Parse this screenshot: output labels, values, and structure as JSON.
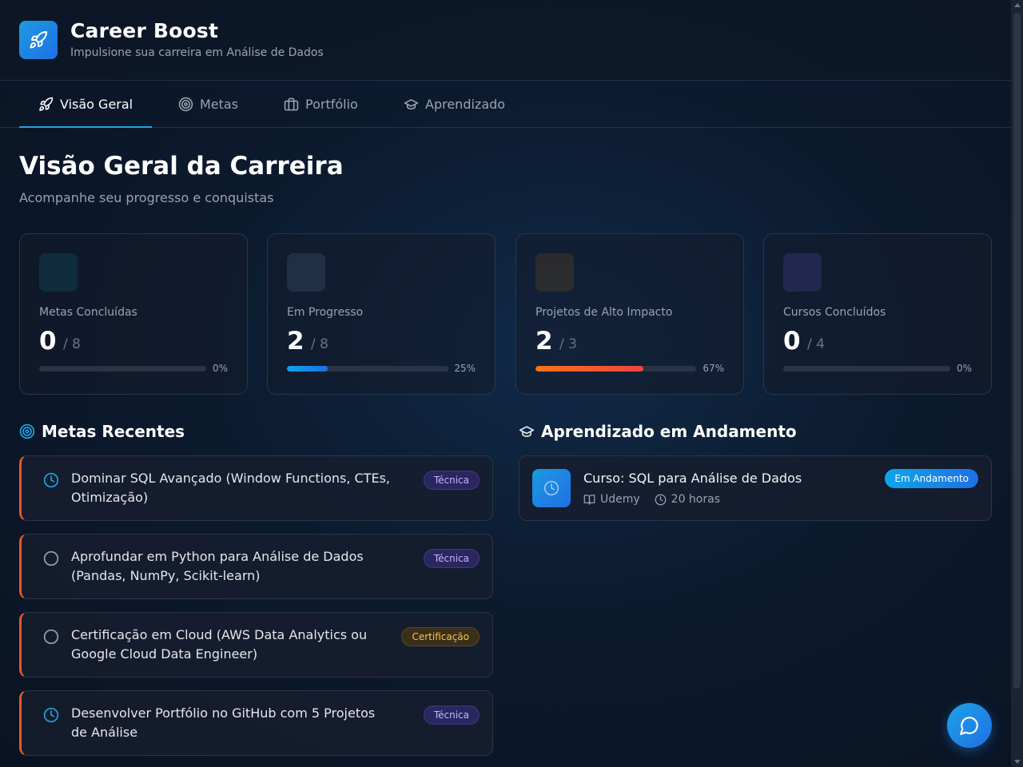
{
  "header": {
    "title": "Career Boost",
    "subtitle": "Impulsione sua carreira em Análise de Dados"
  },
  "tabs": [
    {
      "label": "Visão Geral",
      "icon": "rocket-icon",
      "active": true
    },
    {
      "label": "Metas",
      "icon": "target-icon",
      "active": false
    },
    {
      "label": "Portfólio",
      "icon": "briefcase-icon",
      "active": false
    },
    {
      "label": "Aprendizado",
      "icon": "graduation-cap-icon",
      "active": false
    }
  ],
  "main": {
    "title": "Visão Geral da Carreira",
    "subtitle": "Acompanhe seu progresso e conquistas"
  },
  "stats": [
    {
      "label": "Metas Concluídas",
      "value": "0",
      "total": "/ 8",
      "percent": "0%",
      "progress": 0,
      "color": "#1e9ae0"
    },
    {
      "label": "Em Progresso",
      "value": "2",
      "total": "/ 8",
      "percent": "25%",
      "progress": 0.25,
      "color": "#1e9ae0"
    },
    {
      "label": "Projetos de Alto Impacto",
      "value": "2",
      "total": "/ 3",
      "percent": "67%",
      "progress": 0.67,
      "color": "#f97316"
    },
    {
      "label": "Cursos Concluídos",
      "value": "0",
      "total": "/ 4",
      "percent": "0%",
      "progress": 0,
      "color": "#6366f1"
    }
  ],
  "recent_goals": {
    "title": "Metas Recentes",
    "items": [
      {
        "text": "Dominar SQL Avançado (Window Functions, CTEs, Otimização)",
        "badge": "Técnica",
        "status": "in-progress"
      },
      {
        "text": "Aprofundar em Python para Análise de Dados (Pandas, NumPy, Scikit-learn)",
        "badge": "Técnica",
        "status": "not-started"
      },
      {
        "text": "Certificação em Cloud (AWS Data Analytics ou Google Cloud Data Engineer)",
        "badge": "Certificação",
        "status": "not-started"
      },
      {
        "text": "Desenvolver Portfólio no GitHub com 5 Projetos de Análise",
        "badge": "Técnica",
        "status": "in-progress"
      }
    ]
  },
  "learning": {
    "title": "Aprendizado em Andamento",
    "items": [
      {
        "title": "Curso: SQL para Análise de Dados",
        "platform": "Udemy",
        "duration": "20 horas",
        "badge": "Em Andamento"
      }
    ]
  },
  "colors": {
    "accent": "#1ea3e6",
    "goal_border": "#e4562f",
    "orange": "#f97316"
  }
}
